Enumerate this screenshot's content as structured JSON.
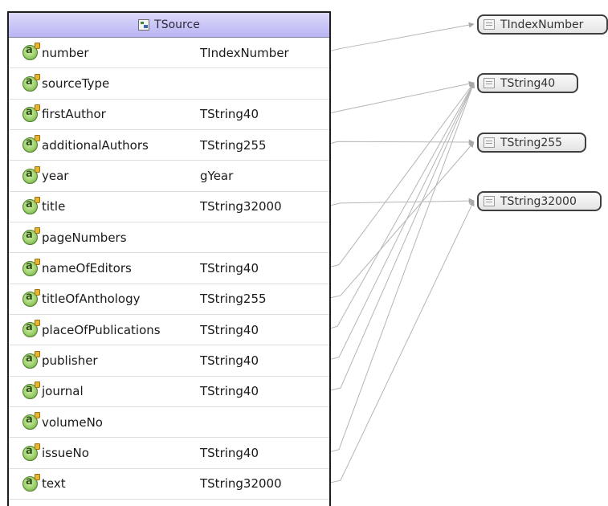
{
  "entity": {
    "title": "TSource",
    "icon": "class-icon",
    "attributes": [
      {
        "name": "number",
        "type": "TIndexNumber"
      },
      {
        "name": "sourceType",
        "type": ""
      },
      {
        "name": "firstAuthor",
        "type": "TString40"
      },
      {
        "name": "additionalAuthors",
        "type": "TString255"
      },
      {
        "name": "year",
        "type": "gYear"
      },
      {
        "name": "title",
        "type": "TString32000"
      },
      {
        "name": "pageNumbers",
        "type": ""
      },
      {
        "name": "nameOfEditors",
        "type": "TString40"
      },
      {
        "name": "titleOfAnthology",
        "type": "TString255"
      },
      {
        "name": "placeOfPublications",
        "type": "TString40"
      },
      {
        "name": "publisher",
        "type": "TString40"
      },
      {
        "name": "journal",
        "type": "TString40"
      },
      {
        "name": "volumeNo",
        "type": ""
      },
      {
        "name": "issueNo",
        "type": "TString40"
      },
      {
        "name": "text",
        "type": "TString32000"
      }
    ]
  },
  "types": [
    {
      "name": "TIndexNumber",
      "icon": "simple-type-icon"
    },
    {
      "name": "TString40",
      "icon": "simple-type-icon"
    },
    {
      "name": "TString255",
      "icon": "simple-type-icon"
    },
    {
      "name": "TString32000",
      "icon": "simple-type-icon"
    }
  ],
  "colors": {
    "header_gradient_top": "#dcd9fb",
    "header_gradient_bottom": "#b9b4f2",
    "connector": "#b5b5b5",
    "attribute_icon": "#9cd06a"
  }
}
